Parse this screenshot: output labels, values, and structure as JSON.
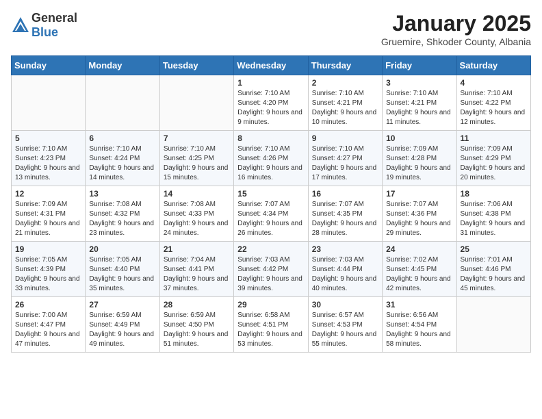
{
  "header": {
    "logo_general": "General",
    "logo_blue": "Blue",
    "month_title": "January 2025",
    "location": "Gruemire, Shkoder County, Albania"
  },
  "days_of_week": [
    "Sunday",
    "Monday",
    "Tuesday",
    "Wednesday",
    "Thursday",
    "Friday",
    "Saturday"
  ],
  "weeks": [
    [
      {
        "day": "",
        "sunrise": "",
        "sunset": "",
        "daylight": ""
      },
      {
        "day": "",
        "sunrise": "",
        "sunset": "",
        "daylight": ""
      },
      {
        "day": "",
        "sunrise": "",
        "sunset": "",
        "daylight": ""
      },
      {
        "day": "1",
        "sunrise": "Sunrise: 7:10 AM",
        "sunset": "Sunset: 4:20 PM",
        "daylight": "Daylight: 9 hours and 9 minutes."
      },
      {
        "day": "2",
        "sunrise": "Sunrise: 7:10 AM",
        "sunset": "Sunset: 4:21 PM",
        "daylight": "Daylight: 9 hours and 10 minutes."
      },
      {
        "day": "3",
        "sunrise": "Sunrise: 7:10 AM",
        "sunset": "Sunset: 4:21 PM",
        "daylight": "Daylight: 9 hours and 11 minutes."
      },
      {
        "day": "4",
        "sunrise": "Sunrise: 7:10 AM",
        "sunset": "Sunset: 4:22 PM",
        "daylight": "Daylight: 9 hours and 12 minutes."
      }
    ],
    [
      {
        "day": "5",
        "sunrise": "Sunrise: 7:10 AM",
        "sunset": "Sunset: 4:23 PM",
        "daylight": "Daylight: 9 hours and 13 minutes."
      },
      {
        "day": "6",
        "sunrise": "Sunrise: 7:10 AM",
        "sunset": "Sunset: 4:24 PM",
        "daylight": "Daylight: 9 hours and 14 minutes."
      },
      {
        "day": "7",
        "sunrise": "Sunrise: 7:10 AM",
        "sunset": "Sunset: 4:25 PM",
        "daylight": "Daylight: 9 hours and 15 minutes."
      },
      {
        "day": "8",
        "sunrise": "Sunrise: 7:10 AM",
        "sunset": "Sunset: 4:26 PM",
        "daylight": "Daylight: 9 hours and 16 minutes."
      },
      {
        "day": "9",
        "sunrise": "Sunrise: 7:10 AM",
        "sunset": "Sunset: 4:27 PM",
        "daylight": "Daylight: 9 hours and 17 minutes."
      },
      {
        "day": "10",
        "sunrise": "Sunrise: 7:09 AM",
        "sunset": "Sunset: 4:28 PM",
        "daylight": "Daylight: 9 hours and 19 minutes."
      },
      {
        "day": "11",
        "sunrise": "Sunrise: 7:09 AM",
        "sunset": "Sunset: 4:29 PM",
        "daylight": "Daylight: 9 hours and 20 minutes."
      }
    ],
    [
      {
        "day": "12",
        "sunrise": "Sunrise: 7:09 AM",
        "sunset": "Sunset: 4:31 PM",
        "daylight": "Daylight: 9 hours and 21 minutes."
      },
      {
        "day": "13",
        "sunrise": "Sunrise: 7:08 AM",
        "sunset": "Sunset: 4:32 PM",
        "daylight": "Daylight: 9 hours and 23 minutes."
      },
      {
        "day": "14",
        "sunrise": "Sunrise: 7:08 AM",
        "sunset": "Sunset: 4:33 PM",
        "daylight": "Daylight: 9 hours and 24 minutes."
      },
      {
        "day": "15",
        "sunrise": "Sunrise: 7:07 AM",
        "sunset": "Sunset: 4:34 PM",
        "daylight": "Daylight: 9 hours and 26 minutes."
      },
      {
        "day": "16",
        "sunrise": "Sunrise: 7:07 AM",
        "sunset": "Sunset: 4:35 PM",
        "daylight": "Daylight: 9 hours and 28 minutes."
      },
      {
        "day": "17",
        "sunrise": "Sunrise: 7:07 AM",
        "sunset": "Sunset: 4:36 PM",
        "daylight": "Daylight: 9 hours and 29 minutes."
      },
      {
        "day": "18",
        "sunrise": "Sunrise: 7:06 AM",
        "sunset": "Sunset: 4:38 PM",
        "daylight": "Daylight: 9 hours and 31 minutes."
      }
    ],
    [
      {
        "day": "19",
        "sunrise": "Sunrise: 7:05 AM",
        "sunset": "Sunset: 4:39 PM",
        "daylight": "Daylight: 9 hours and 33 minutes."
      },
      {
        "day": "20",
        "sunrise": "Sunrise: 7:05 AM",
        "sunset": "Sunset: 4:40 PM",
        "daylight": "Daylight: 9 hours and 35 minutes."
      },
      {
        "day": "21",
        "sunrise": "Sunrise: 7:04 AM",
        "sunset": "Sunset: 4:41 PM",
        "daylight": "Daylight: 9 hours and 37 minutes."
      },
      {
        "day": "22",
        "sunrise": "Sunrise: 7:03 AM",
        "sunset": "Sunset: 4:42 PM",
        "daylight": "Daylight: 9 hours and 39 minutes."
      },
      {
        "day": "23",
        "sunrise": "Sunrise: 7:03 AM",
        "sunset": "Sunset: 4:44 PM",
        "daylight": "Daylight: 9 hours and 40 minutes."
      },
      {
        "day": "24",
        "sunrise": "Sunrise: 7:02 AM",
        "sunset": "Sunset: 4:45 PM",
        "daylight": "Daylight: 9 hours and 42 minutes."
      },
      {
        "day": "25",
        "sunrise": "Sunrise: 7:01 AM",
        "sunset": "Sunset: 4:46 PM",
        "daylight": "Daylight: 9 hours and 45 minutes."
      }
    ],
    [
      {
        "day": "26",
        "sunrise": "Sunrise: 7:00 AM",
        "sunset": "Sunset: 4:47 PM",
        "daylight": "Daylight: 9 hours and 47 minutes."
      },
      {
        "day": "27",
        "sunrise": "Sunrise: 6:59 AM",
        "sunset": "Sunset: 4:49 PM",
        "daylight": "Daylight: 9 hours and 49 minutes."
      },
      {
        "day": "28",
        "sunrise": "Sunrise: 6:59 AM",
        "sunset": "Sunset: 4:50 PM",
        "daylight": "Daylight: 9 hours and 51 minutes."
      },
      {
        "day": "29",
        "sunrise": "Sunrise: 6:58 AM",
        "sunset": "Sunset: 4:51 PM",
        "daylight": "Daylight: 9 hours and 53 minutes."
      },
      {
        "day": "30",
        "sunrise": "Sunrise: 6:57 AM",
        "sunset": "Sunset: 4:53 PM",
        "daylight": "Daylight: 9 hours and 55 minutes."
      },
      {
        "day": "31",
        "sunrise": "Sunrise: 6:56 AM",
        "sunset": "Sunset: 4:54 PM",
        "daylight": "Daylight: 9 hours and 58 minutes."
      },
      {
        "day": "",
        "sunrise": "",
        "sunset": "",
        "daylight": ""
      }
    ]
  ]
}
